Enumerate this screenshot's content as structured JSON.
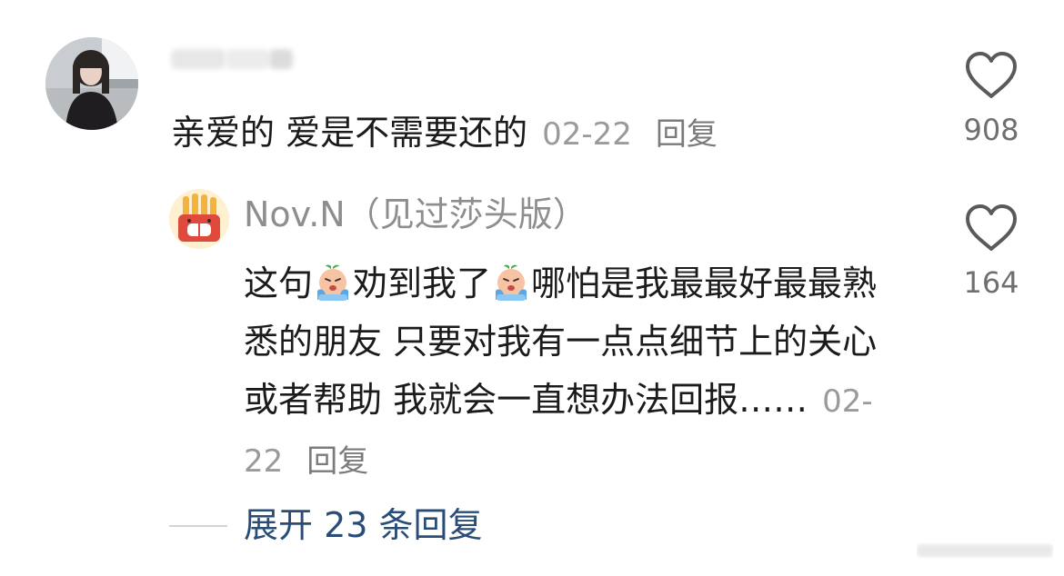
{
  "comment": {
    "text": "亲爱的 爱是不需要还的",
    "date": "02-22",
    "reply_label": "回复",
    "like_count": "908"
  },
  "reply": {
    "username": "Nov.N（见过莎头版）",
    "body_part1": "这句",
    "body_part2": "劝到我了",
    "body_part3": "哪怕是我最最好最最熟悉的朋友 只要对我有一点点细节上的关心或者帮助 我就会一直想办法回报……",
    "date": "02-22",
    "reply_label": "回复",
    "like_count": "164"
  },
  "expand": {
    "label": "展开 23 条回复"
  },
  "icons": {
    "like": "heart-outline-icon",
    "emoji": "crying-emoji-icon"
  },
  "colors": {
    "link": "#2a4d78",
    "muted": "#9a9a9a",
    "text": "#1b1b1b"
  }
}
